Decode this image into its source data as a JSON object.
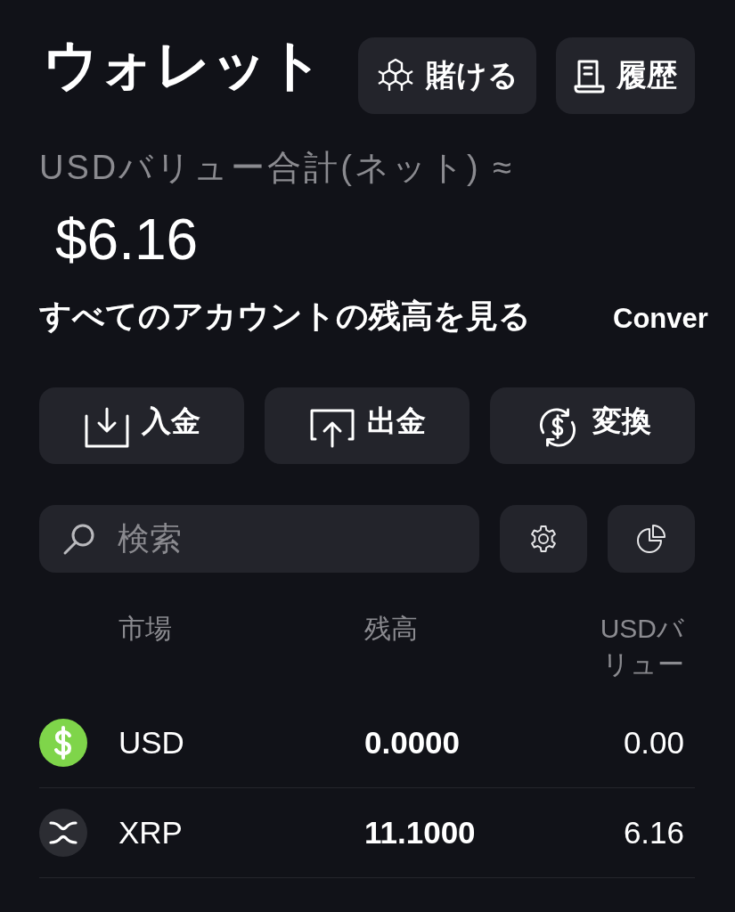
{
  "header": {
    "title": "ウォレット",
    "buttons": [
      {
        "label": "賭ける",
        "kind": "stake"
      },
      {
        "label": "履歴",
        "kind": "history"
      }
    ]
  },
  "total": {
    "label": "USDバリュー合計(ネット) ≈",
    "value": "$6.16",
    "link": "すべてのアカウントの残高を見る",
    "convert": "Conver"
  },
  "actions": [
    {
      "label": "入金",
      "kind": "deposit"
    },
    {
      "label": "出金",
      "kind": "withdraw"
    },
    {
      "label": "変換",
      "kind": "convert"
    }
  ],
  "search": {
    "placeholder": "検索"
  },
  "table": {
    "columns": [
      "市場",
      "残高",
      "USDバリュー"
    ],
    "rows": [
      {
        "kind": "usd",
        "market": "USD",
        "balance": "0.0000",
        "usd_value": "0.00"
      },
      {
        "kind": "xrp",
        "market": "XRP",
        "balance": "11.1000",
        "usd_value": "6.16"
      }
    ]
  }
}
